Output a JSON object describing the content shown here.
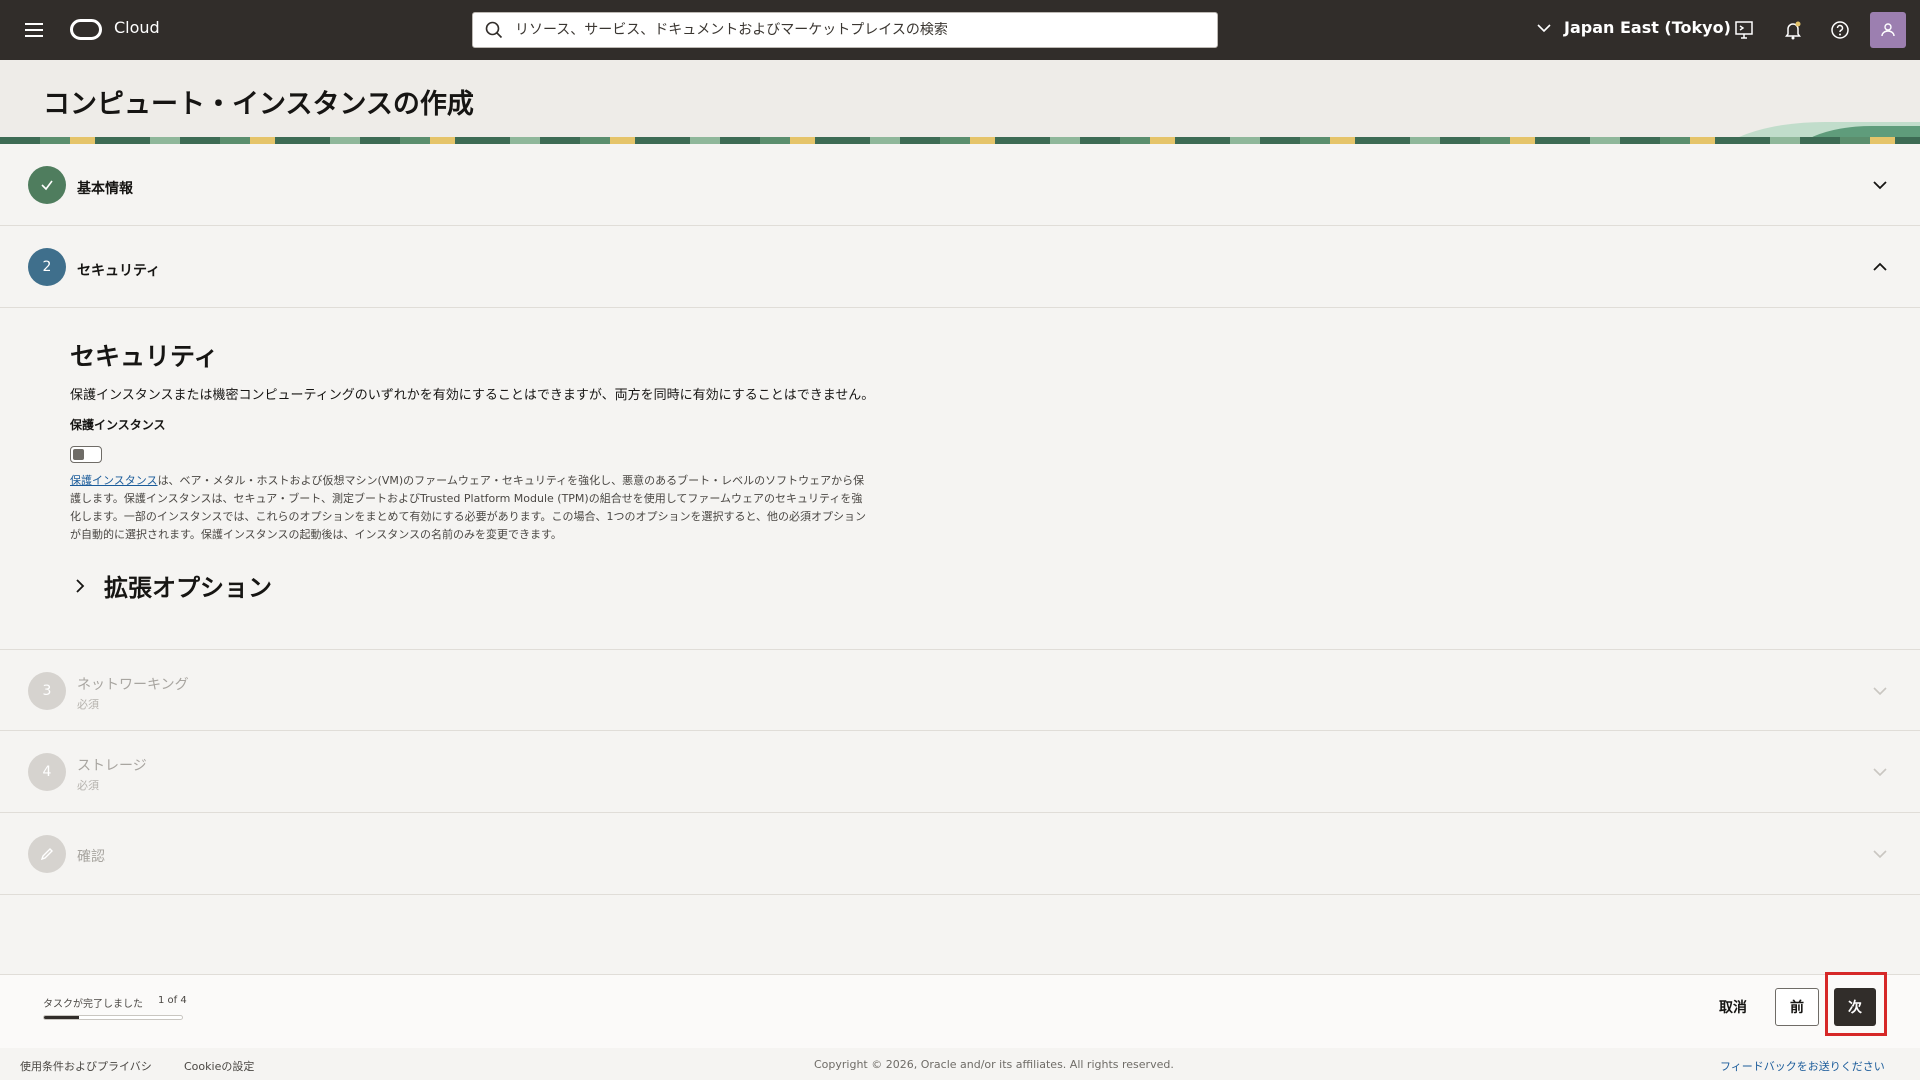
{
  "header": {
    "brand": "Cloud",
    "search_placeholder": "リソース、サービス、ドキュメントおよびマーケットプレイスの検索",
    "region": "Japan East (Tokyo)"
  },
  "page": {
    "title": "コンピュート・インスタンスの作成"
  },
  "steps": [
    {
      "number": "",
      "label": "基本情報",
      "status": "complete"
    },
    {
      "number": "2",
      "label": "セキュリティ",
      "status": "active"
    },
    {
      "number": "3",
      "label": "ネットワーキング",
      "sub": "必須",
      "status": "disabled"
    },
    {
      "number": "4",
      "label": "ストレージ",
      "sub": "必須",
      "status": "disabled"
    },
    {
      "number": "",
      "label": "確認",
      "status": "disabled"
    }
  ],
  "security": {
    "heading": "セキュリティ",
    "description": "保護インスタンスまたは機密コンピューティングのいずれかを有効にすることはできますが、両方を同時に有効にすることはできません。",
    "shielded_label": "保護インスタンス",
    "shielded_enabled": false,
    "help_link": "保護インスタンス",
    "help_text": "は、ベア・メタル・ホストおよび仮想マシン(VM)のファームウェア・セキュリティを強化し、悪意のあるブート・レベルのソフトウェアから保護します。保護インスタンスは、セキュア・ブート、測定ブートおよびTrusted Platform Module (TPM)の組合せを使用してファームウェアのセキュリティを強化します。一部のインスタンスでは、これらのオプションをまとめて有効にする必要があります。この場合、1つのオプションを選択すると、他の必須オプションが自動的に選択されます。保護インスタンスの起動後は、インスタンスの名前のみを変更できます。",
    "advanced_options": "拡張オプション"
  },
  "actionbar": {
    "progress_label": "タスクが完了しました",
    "progress_count": "1 of 4",
    "progress_fraction": 0.25,
    "cancel": "取消",
    "prev": "前",
    "next": "次"
  },
  "footer": {
    "terms": "使用条件およびプライバシ",
    "cookie": "Cookieの設定",
    "copyright": "Copyright © 2026, Oracle and/or its affiliates. All rights reserved.",
    "feedback": "フィードバックをお送りください"
  },
  "colors": {
    "step_complete": "#4f7d5e",
    "step_active": "#3f6f8c",
    "topbar": "#312d2a"
  }
}
